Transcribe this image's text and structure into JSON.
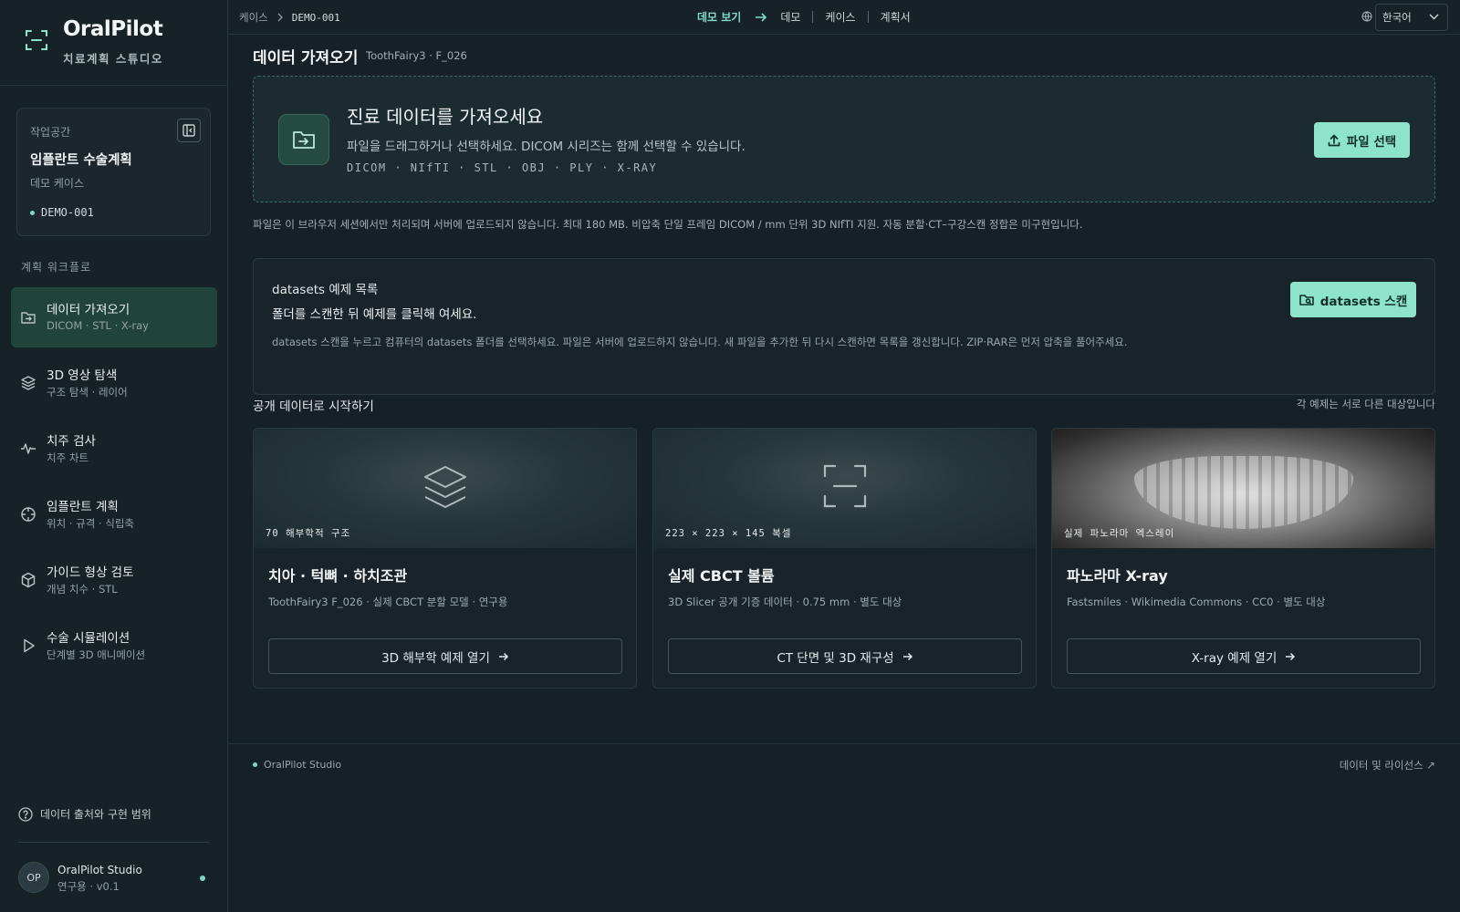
{
  "brand": {
    "name": "OralPilot",
    "subtitle": "치료계획 스튜디오"
  },
  "workspace": {
    "label": "작업공간",
    "title": "임플란트 수술계획",
    "subtitle": "데모 케이스",
    "case_id": "DEMO-001"
  },
  "workflow": {
    "label": "계획 워크플로",
    "items": [
      {
        "title": "데이터 가져오기",
        "sub": "DICOM · STL · X-ray",
        "active": true
      },
      {
        "title": "3D 영상 탐색",
        "sub": "구조 탐색 · 레이어"
      },
      {
        "title": "치주 검사",
        "sub": "치주 차트"
      },
      {
        "title": "임플란트 계획",
        "sub": "위치 · 규격 · 식립축"
      },
      {
        "title": "가이드 형상 검토",
        "sub": "개념 치수 · STL"
      },
      {
        "title": "수술 시뮬레이션",
        "sub": "단계별 3D 애니메이션"
      }
    ]
  },
  "help": {
    "label": "데이터 출처와 구현 범위"
  },
  "user": {
    "initials": "OP",
    "name": "OralPilot Studio",
    "sub": "연구용 · v0.1"
  },
  "topbar": {
    "crumb_root": "케이스",
    "crumb_current": "DEMO-001",
    "nav_demo_view": "데모 보기",
    "nav_demo": "데모",
    "nav_case": "케이스",
    "nav_plan": "계획서",
    "language": "한국어"
  },
  "main": {
    "title": "데이터 가져오기",
    "subtitle": "ToothFairy3 · F_026",
    "dropzone": {
      "title": "진료 데이터를 가져오세요",
      "desc": "파일을 드래그하거나 선택하세요. DICOM 시리즈는 함께 선택할 수 있습니다.",
      "formats": "DICOM · NIfTI · STL · OBJ · PLY · X-RAY",
      "button": "파일 선택"
    },
    "note": "파일은 이 브라우저 세션에서만 처리되며 서버에 업로드되지 않습니다. 최대 180 MB. 비압축 단일 프레임 DICOM / mm 단위 3D NIfTI 지원. 자동 분할·CT–구강스캔 정합은 미구현입니다.",
    "datasets": {
      "title": "datasets 예제 목록",
      "subtitle": "폴더를 스캔한 뒤 예제를 클릭해 여세요.",
      "desc": "datasets 스캔을 누르고 컴퓨터의 datasets 폴더를 선택하세요. 파일은 서버에 업로드하지 않습니다. 새 파일을 추가한 뒤 다시 스캔하면 목록을 갱신합니다. ZIP·RAR은 먼저 압축을 풀어주세요.",
      "button": "datasets 스캔"
    },
    "public": {
      "title": "공개 데이터로 시작하기",
      "note": "각 예제는 서로 다른 대상입니다",
      "cards": [
        {
          "caption": "70 해부학적 구조",
          "title": "치아 · 턱뼈 · 하치조관",
          "meta": "ToothFairy3 F_026 · 실제 CBCT 분할 모델 · 연구용",
          "button": "3D 해부학 예제 열기",
          "icon": "layers-icon"
        },
        {
          "caption": "223 × 223 × 145 복셀",
          "title": "실제 CBCT 볼륨",
          "meta": "3D Slicer 공개 기증 데이터 · 0.75 mm · 별도 대상",
          "button": "CT 단면 및 3D 재구성",
          "icon": "scan-icon"
        },
        {
          "caption": "실제 파노라마 엑스레이",
          "title": "파노라마 X-ray",
          "meta": "Fastsmiles · Wikimedia Commons · CC0 · 별도 대상",
          "button": "X-ray 예제 열기",
          "icon": "xray-image"
        }
      ]
    }
  },
  "footer": {
    "left": "OralPilot Studio",
    "right": "데이터 및 라이선스 ↗"
  },
  "colors": {
    "accent": "#8ee3cb",
    "background": "#162027",
    "active_nav": "#20443c"
  }
}
